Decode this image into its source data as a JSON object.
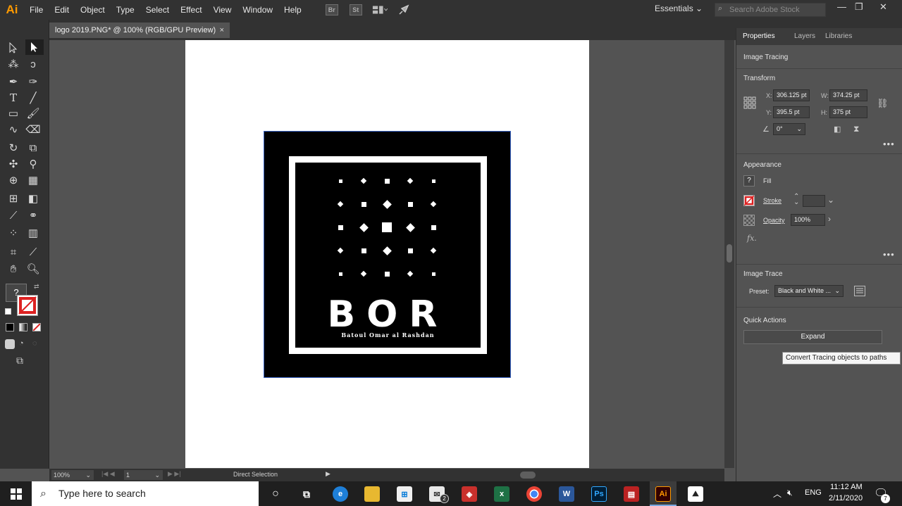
{
  "app": {
    "logo": "Ai",
    "menus": [
      "File",
      "Edit",
      "Object",
      "Type",
      "Select",
      "Effect",
      "View",
      "Window",
      "Help"
    ],
    "bridge_label": "Br",
    "stock_label": "St",
    "workspace": "Essentials",
    "search_placeholder": "Search Adobe Stock"
  },
  "document": {
    "tab_title": "logo 2019.PNG* @ 100% (RGB/GPU Preview)",
    "close": "×"
  },
  "artwork": {
    "letters": "BOR",
    "subtitle": "Batoul Omar al Rashdan"
  },
  "status": {
    "zoom": "100%",
    "artboard": "1",
    "tool_name": "Direct Selection"
  },
  "panel": {
    "tabs": [
      "Properties",
      "Layers",
      "Libraries"
    ],
    "image_tracing": "Image Tracing",
    "transform": {
      "title": "Transform",
      "x_label": "X:",
      "x": "306.125 pt",
      "y_label": "Y:",
      "y": "395.5 pt",
      "w_label": "W:",
      "w": "374.25 pt",
      "h_label": "H:",
      "h": "375 pt",
      "angle": "0°"
    },
    "appearance": {
      "title": "Appearance",
      "fill": "Fill",
      "stroke": "Stroke",
      "opacity_label": "Opacity",
      "opacity": "100%",
      "fx": "fx."
    },
    "image_trace": {
      "title": "Image Trace",
      "preset_label": "Preset:",
      "preset": "Black and White ..."
    },
    "quick_actions": {
      "title": "Quick Actions",
      "expand": "Expand"
    },
    "tooltip": "Convert Tracing objects to paths"
  },
  "taskbar": {
    "search_placeholder": "Type here to search",
    "mail_badge": "2",
    "lang": "ENG",
    "time": "11:12 AM",
    "date": "2/11/2020",
    "notif_count": "7"
  },
  "colors": {
    "ui_dark": "#323232",
    "ui_mid": "#535353",
    "ai_orange": "#ff9a00",
    "selection_blue": "#3b66c8"
  }
}
